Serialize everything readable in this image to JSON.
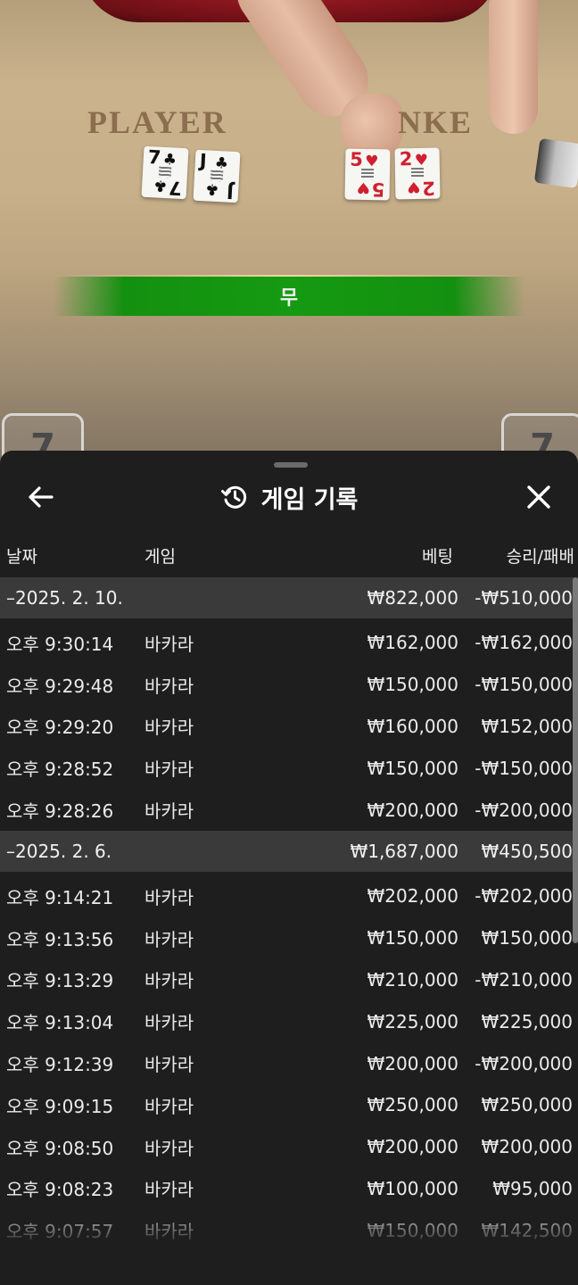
{
  "scene": {
    "player_label": "PLAYER",
    "banker_label": "NKE",
    "result": "무",
    "player_score": "7",
    "banker_score": "7",
    "player_cards": [
      {
        "rank": "7",
        "suit": "♣",
        "color": "black"
      },
      {
        "rank": "J",
        "suit": "♣",
        "color": "black"
      }
    ],
    "banker_cards": [
      {
        "rank": "5",
        "suit": "♥",
        "color": "red"
      },
      {
        "rank": "2",
        "suit": "♥",
        "color": "red"
      }
    ]
  },
  "sheet": {
    "title": "게임 기록",
    "back_icon": "arrow-left-icon",
    "history_icon": "history-icon",
    "close_icon": "close-icon",
    "columns": {
      "date": "날짜",
      "game": "게임",
      "bet": "베팅",
      "result": "승리/패배"
    },
    "groups": [
      {
        "date": "–2025. 2. 10.",
        "bet_total": "₩822,000",
        "result_total": "-₩510,000",
        "rows": [
          {
            "time": "오후 9:30:14",
            "game": "바카라",
            "bet": "₩162,000",
            "result": "-₩162,000"
          },
          {
            "time": "오후 9:29:48",
            "game": "바카라",
            "bet": "₩150,000",
            "result": "-₩150,000"
          },
          {
            "time": "오후 9:29:20",
            "game": "바카라",
            "bet": "₩160,000",
            "result": "₩152,000"
          },
          {
            "time": "오후 9:28:52",
            "game": "바카라",
            "bet": "₩150,000",
            "result": "-₩150,000"
          },
          {
            "time": "오후 9:28:26",
            "game": "바카라",
            "bet": "₩200,000",
            "result": "-₩200,000"
          }
        ]
      },
      {
        "date": "–2025. 2. 6.",
        "bet_total": "₩1,687,000",
        "result_total": "₩450,500",
        "rows": [
          {
            "time": "오후 9:14:21",
            "game": "바카라",
            "bet": "₩202,000",
            "result": "-₩202,000"
          },
          {
            "time": "오후 9:13:56",
            "game": "바카라",
            "bet": "₩150,000",
            "result": "₩150,000"
          },
          {
            "time": "오후 9:13:29",
            "game": "바카라",
            "bet": "₩210,000",
            "result": "-₩210,000"
          },
          {
            "time": "오후 9:13:04",
            "game": "바카라",
            "bet": "₩225,000",
            "result": "₩225,000"
          },
          {
            "time": "오후 9:12:39",
            "game": "바카라",
            "bet": "₩200,000",
            "result": "-₩200,000"
          },
          {
            "time": "오후 9:09:15",
            "game": "바카라",
            "bet": "₩250,000",
            "result": "₩250,000"
          },
          {
            "time": "오후 9:08:50",
            "game": "바카라",
            "bet": "₩200,000",
            "result": "₩200,000"
          },
          {
            "time": "오후 9:08:23",
            "game": "바카라",
            "bet": "₩100,000",
            "result": "₩95,000"
          },
          {
            "time": "오후 9:07:57",
            "game": "바카라",
            "bet": "₩150,000",
            "result": "₩142,500"
          }
        ]
      }
    ]
  }
}
